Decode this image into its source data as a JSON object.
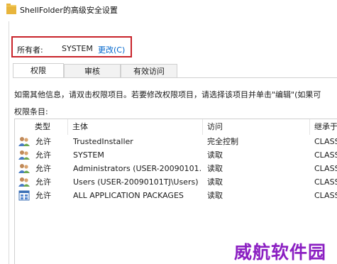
{
  "window": {
    "title": "ShellFolder的高级安全设置"
  },
  "owner": {
    "label": "所有者:",
    "value": "SYSTEM",
    "change_link": "更改(C)"
  },
  "tabs": [
    {
      "label": "权限",
      "active": true
    },
    {
      "label": "审核",
      "active": false
    },
    {
      "label": "有效访问",
      "active": false
    }
  ],
  "info_text": "如需其他信息，请双击权限项目。若要修改权限项目，请选择该项目并单击\"编辑\"(如果可",
  "entries_label": "权限条目:",
  "table": {
    "headers": [
      "类型",
      "主体",
      "访问",
      "继承于"
    ],
    "rows": [
      {
        "icon": "users-icon",
        "type": "允许",
        "principal": "TrustedInstaller",
        "access": "完全控制",
        "inherited": "CLASS"
      },
      {
        "icon": "users-icon",
        "type": "允许",
        "principal": "SYSTEM",
        "access": "读取",
        "inherited": "CLASS"
      },
      {
        "icon": "users-icon",
        "type": "允许",
        "principal": "Administrators (USER-20090101...",
        "access": "读取",
        "inherited": "CLASS"
      },
      {
        "icon": "users-icon",
        "type": "允许",
        "principal": "Users (USER-20090101TJ\\Users)",
        "access": "读取",
        "inherited": "CLASS"
      },
      {
        "icon": "app-packages-icon",
        "type": "允许",
        "principal": "ALL APPLICATION PACKAGES",
        "access": "读取",
        "inherited": "CLASS"
      }
    ]
  },
  "watermark": "威航软件园"
}
